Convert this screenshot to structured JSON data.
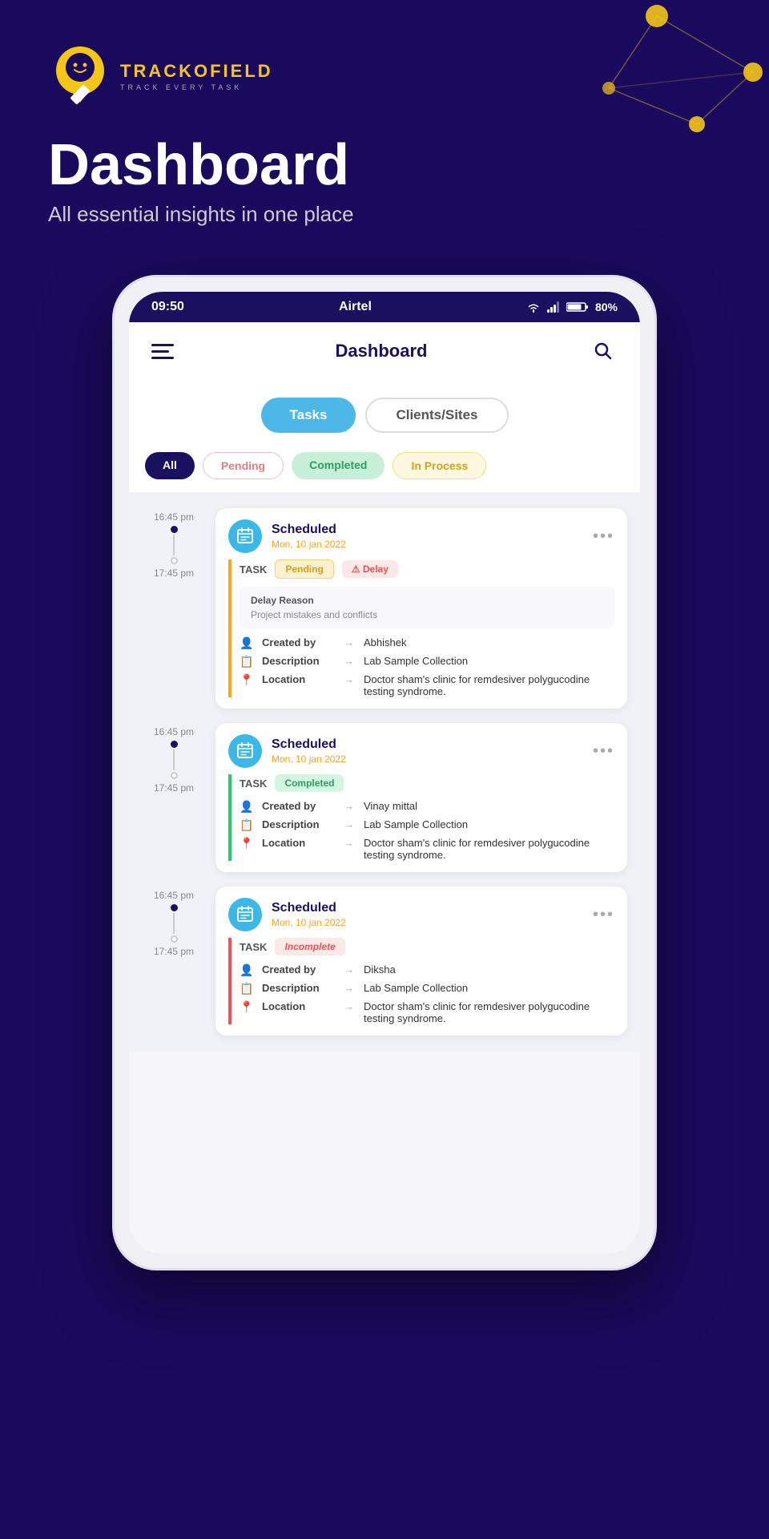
{
  "app": {
    "logo_name_part1": "TRACKO",
    "logo_name_part2": "FIELD",
    "logo_tagline": "TRACK EVERY TASK",
    "dashboard_title": "Dashboard",
    "dashboard_subtitle": "All essential insights in one place"
  },
  "status_bar": {
    "time": "09:50",
    "carrier": "Airtel",
    "battery": "80%"
  },
  "nav": {
    "title": "Dashboard"
  },
  "tabs": {
    "tasks_label": "Tasks",
    "clients_label": "Clients/Sites"
  },
  "filters": {
    "all": "All",
    "pending": "Pending",
    "completed": "Completed",
    "in_process": "In Process"
  },
  "cards": [
    {
      "status": "Scheduled",
      "date": "Mon, 10 jan 2022",
      "task_label": "TASK",
      "badge1": "Pending",
      "badge2": "Delay",
      "has_delay_reason": true,
      "delay_reason_title": "Delay Reason",
      "delay_reason_text": "Project mistakes and conflicts",
      "accent": "yellow",
      "created_by_label": "Created by",
      "created_by": "Abhishek",
      "description_label": "Description",
      "description": "Lab Sample Collection",
      "location_label": "Location",
      "location": "Doctor sham's clinic for remdesiver polygucodine testing syndrome.",
      "time_start": "16:45 pm",
      "time_end": "17:45 pm"
    },
    {
      "status": "Scheduled",
      "date": "Mon, 10 jan 2022",
      "task_label": "TASK",
      "badge1": "Completed",
      "badge2": null,
      "has_delay_reason": false,
      "accent": "green",
      "created_by_label": "Created by",
      "created_by": "Vinay mittal",
      "description_label": "Description",
      "description": "Lab Sample Collection",
      "location_label": "Location",
      "location": "Doctor sham's clinic for remdesiver polygucodine testing syndrome.",
      "time_start": "16:45 pm",
      "time_end": "17:45 pm"
    },
    {
      "status": "Scheduled",
      "date": "Mon, 10 jan 2022",
      "task_label": "TASK",
      "badge1": "Incomplete",
      "badge2": null,
      "has_delay_reason": false,
      "accent": "red",
      "created_by_label": "Created by",
      "created_by": "Diksha",
      "description_label": "Description",
      "description": "Lab Sample Collection",
      "location_label": "Location",
      "location": "Doctor sham's clinic for remdesiver polygucodine testing syndrome.",
      "time_start": "16:45 pm",
      "time_end": "17:45 pm"
    }
  ],
  "icons": {
    "hamburger": "☰",
    "search": "🔍",
    "user": "👤",
    "doc": "📋",
    "pin": "📍",
    "three_dots": "•••"
  }
}
